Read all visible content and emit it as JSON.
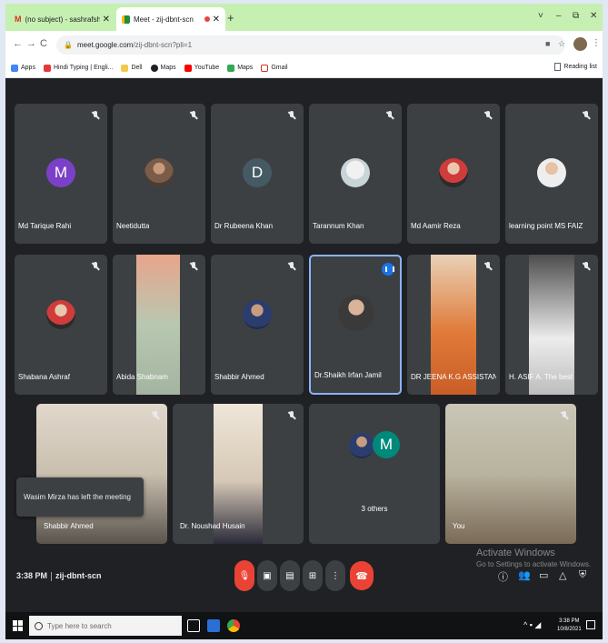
{
  "browser": {
    "tabs": [
      {
        "title": "(no subject) - sashrafshabana@g",
        "active": false
      },
      {
        "title": "Meet - zij-dbnt-scn",
        "active": true,
        "recording": true
      }
    ],
    "new_tab": "+",
    "window_controls": [
      "˅",
      "–",
      "⧉",
      "✕"
    ],
    "url": "meet.google.com",
    "url_path": "/zij-dbnt-scn?pli=1",
    "bookmarks": [
      "Apps",
      "Hindi Typing | Engli...",
      "Dell",
      "Maps",
      "YouTube",
      "Maps",
      "Gmail"
    ],
    "reading_list": "Reading list"
  },
  "participants": [
    {
      "name": "Md Tarique Rahi",
      "avatar_letter": "M",
      "avatar_color": "#7b40c8",
      "muted": true
    },
    {
      "name": "Neetidutta",
      "muted": true
    },
    {
      "name": "Dr Rubeena Khan",
      "avatar_letter": "D",
      "avatar_color": "#455a64",
      "muted": true
    },
    {
      "name": "Tarannum Khan",
      "muted": true
    },
    {
      "name": "Md Aamir Reza",
      "muted": true
    },
    {
      "name": "learning point MS FAIZ",
      "muted": true
    },
    {
      "name": "Shabana Ashraf",
      "muted": true
    },
    {
      "name": "Abida Shabnam",
      "muted": true
    },
    {
      "name": "Shabbir Ahmed",
      "muted": true
    },
    {
      "name": "Dr.Shaikh Irfan Jamil",
      "speaking": true
    },
    {
      "name": "DR JEENA K.G ASSISTAN...",
      "muted": true
    },
    {
      "name": "H. ASIF A. The best",
      "muted": true
    },
    {
      "name": "Shabbir Ahmed",
      "muted": true
    },
    {
      "name": "Dr. Noushad Husain",
      "muted": true
    },
    {
      "name": "3 others",
      "avatar_letter": "M",
      "avatar_color": "#00897b"
    },
    {
      "name": "You",
      "muted": true
    }
  ],
  "toast": "Wasim Mirza has left the meeting",
  "meeting": {
    "time": "3:38 PM",
    "code": "zij-dbnt-scn"
  },
  "activation": {
    "title": "Activate Windows",
    "subtitle": "Go to Settings to activate Windows."
  },
  "taskbar": {
    "search_placeholder": "Type here to search",
    "clock_time": "3:38 PM",
    "clock_date": "10/8/2021"
  }
}
